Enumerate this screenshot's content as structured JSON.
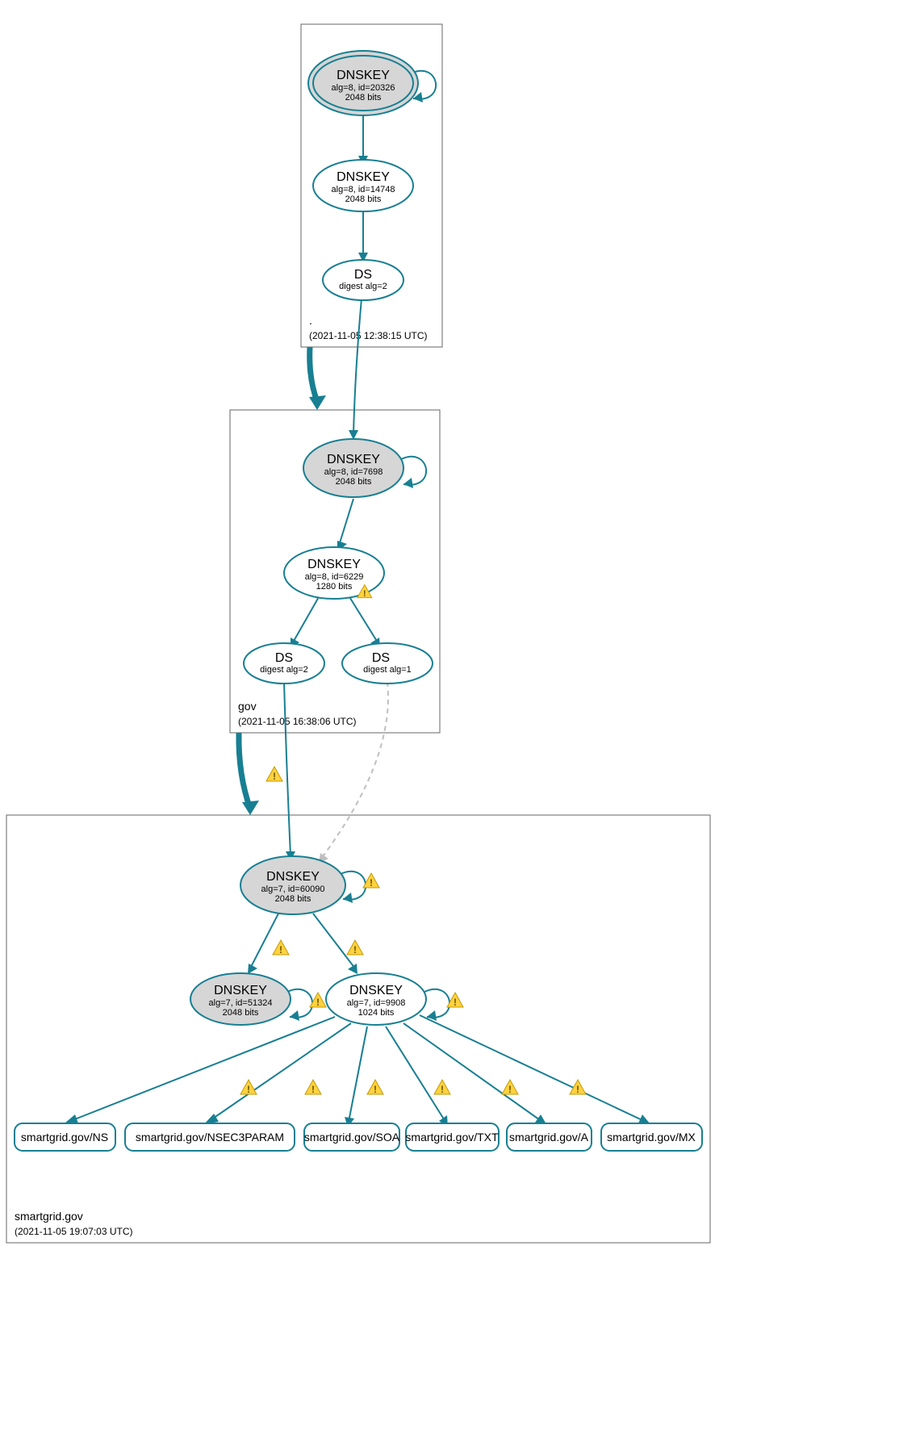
{
  "zones": {
    "root": {
      "label": ".",
      "timestamp": "(2021-11-05 12:38:15 UTC)"
    },
    "gov": {
      "label": "gov",
      "timestamp": "(2021-11-05 16:38:06 UTC)"
    },
    "smartgrid": {
      "label": "smartgrid.gov",
      "timestamp": "(2021-11-05 19:07:03 UTC)"
    }
  },
  "nodes": {
    "root_key1": {
      "title": "DNSKEY",
      "line2": "alg=8, id=20326",
      "line3": "2048 bits"
    },
    "root_key2": {
      "title": "DNSKEY",
      "line2": "alg=8, id=14748",
      "line3": "2048 bits"
    },
    "root_ds": {
      "title": "DS",
      "line2": "digest alg=2"
    },
    "gov_key1": {
      "title": "DNSKEY",
      "line2": "alg=8, id=7698",
      "line3": "2048 bits"
    },
    "gov_key2": {
      "title": "DNSKEY",
      "line2": "alg=8, id=6229",
      "line3": "1280 bits"
    },
    "gov_ds1": {
      "title": "DS",
      "line2": "digest alg=2"
    },
    "gov_ds2": {
      "title": "DS",
      "line2": "digest alg=1"
    },
    "sg_key1": {
      "title": "DNSKEY",
      "line2": "alg=7, id=60090",
      "line3": "2048 bits"
    },
    "sg_key2": {
      "title": "DNSKEY",
      "line2": "alg=7, id=51324",
      "line3": "2048 bits"
    },
    "sg_key3": {
      "title": "DNSKEY",
      "line2": "alg=7, id=9908",
      "line3": "1024 bits"
    },
    "rr_ns": {
      "label": "smartgrid.gov/NS"
    },
    "rr_nsec": {
      "label": "smartgrid.gov/NSEC3PARAM"
    },
    "rr_soa": {
      "label": "smartgrid.gov/SOA"
    },
    "rr_txt": {
      "label": "smartgrid.gov/TXT"
    },
    "rr_a": {
      "label": "smartgrid.gov/A"
    },
    "rr_mx": {
      "label": "smartgrid.gov/MX"
    }
  }
}
